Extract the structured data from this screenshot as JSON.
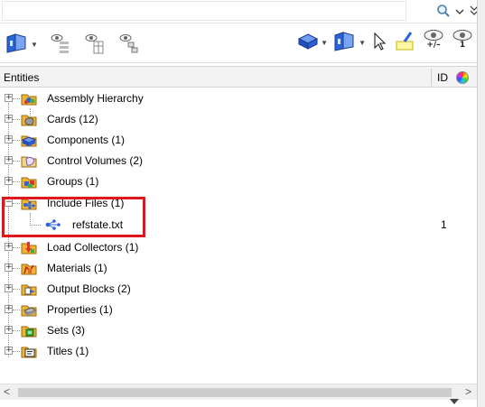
{
  "search": {
    "value": "",
    "placeholder": ""
  },
  "toolbar": {
    "eye_plus_minus_sub": "+/–",
    "eye_one_sub": "1"
  },
  "header": {
    "entities": "Entities",
    "id": "ID"
  },
  "tree": {
    "items": [
      {
        "label": "Assembly Hierarchy",
        "icon": "assembly-hierarchy-icon"
      },
      {
        "label": "Cards (12)",
        "icon": "cards-icon"
      },
      {
        "label": "Components (1)",
        "icon": "components-icon"
      },
      {
        "label": "Control Volumes (2)",
        "icon": "control-volumes-icon"
      },
      {
        "label": "Groups (1)",
        "icon": "groups-icon"
      },
      {
        "label": "Include Files (1)",
        "icon": "include-files-icon",
        "expanded": true,
        "children": [
          {
            "label": "refstate.txt",
            "id": "1",
            "icon": "include-file-icon"
          }
        ]
      },
      {
        "label": "Load Collectors (1)",
        "icon": "load-collectors-icon"
      },
      {
        "label": "Materials (1)",
        "icon": "materials-icon"
      },
      {
        "label": "Output Blocks (2)",
        "icon": "output-blocks-icon"
      },
      {
        "label": "Properties (1)",
        "icon": "properties-icon"
      },
      {
        "label": "Sets (3)",
        "icon": "sets-icon"
      },
      {
        "label": "Titles (1)",
        "icon": "titles-icon"
      }
    ]
  },
  "colors": {
    "highlight": "#e0161c",
    "accent_blue": "#1e5ed6"
  }
}
